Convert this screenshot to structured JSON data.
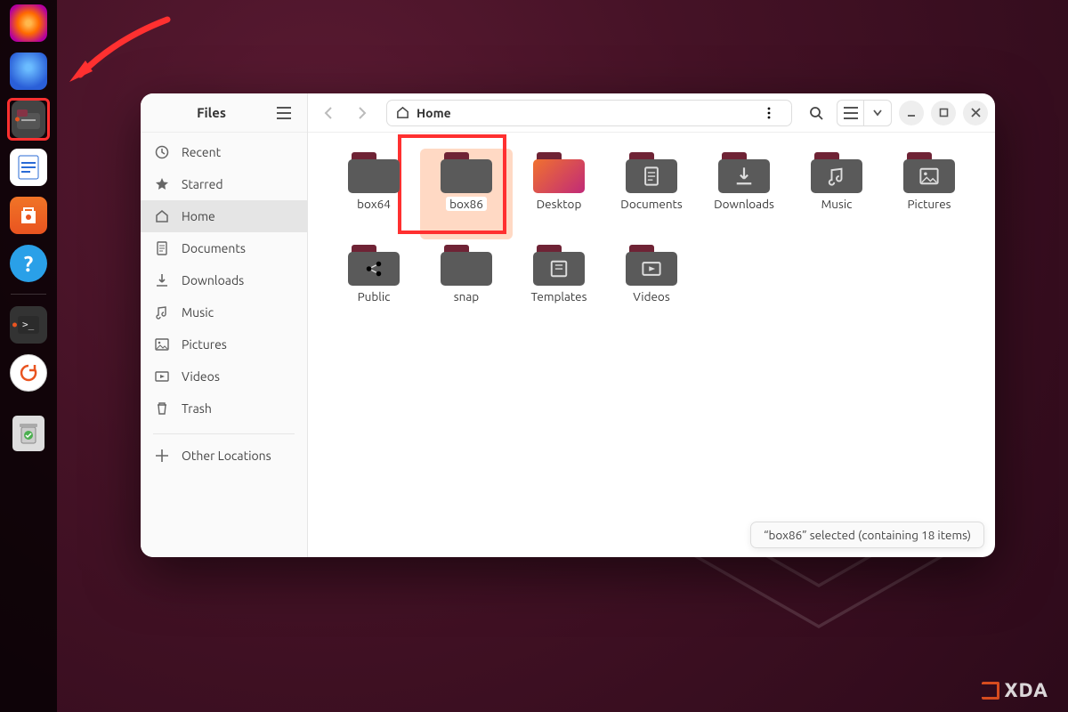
{
  "dock": {
    "items": [
      "firefox",
      "thunderbird",
      "files",
      "libreoffice",
      "software",
      "help",
      "terminal",
      "updater",
      "trash"
    ]
  },
  "sidebar": {
    "title": "Files",
    "items": [
      {
        "icon": "clock",
        "label": "Recent"
      },
      {
        "icon": "star",
        "label": "Starred"
      },
      {
        "icon": "home",
        "label": "Home",
        "active": true
      },
      {
        "icon": "doc",
        "label": "Documents"
      },
      {
        "icon": "download",
        "label": "Downloads"
      },
      {
        "icon": "music",
        "label": "Music"
      },
      {
        "icon": "image",
        "label": "Pictures"
      },
      {
        "icon": "video",
        "label": "Videos"
      },
      {
        "icon": "trash",
        "label": "Trash"
      }
    ],
    "other": "Other Locations"
  },
  "path": {
    "crumb": "Home"
  },
  "items": [
    {
      "name": "box64",
      "type": "folder"
    },
    {
      "name": "box86",
      "type": "folder",
      "selected": true
    },
    {
      "name": "Desktop",
      "type": "folder",
      "variant": "special"
    },
    {
      "name": "Documents",
      "type": "folder",
      "icon": "doc"
    },
    {
      "name": "Downloads",
      "type": "folder",
      "icon": "download"
    },
    {
      "name": "Music",
      "type": "folder",
      "icon": "music"
    },
    {
      "name": "Pictures",
      "type": "folder",
      "icon": "image"
    },
    {
      "name": "Public",
      "type": "folder",
      "icon": "share"
    },
    {
      "name": "snap",
      "type": "folder"
    },
    {
      "name": "Templates",
      "type": "folder",
      "icon": "template"
    },
    {
      "name": "Videos",
      "type": "folder",
      "icon": "video"
    }
  ],
  "status": "“box86” selected  (containing 18 items)",
  "watermark": "XDA"
}
